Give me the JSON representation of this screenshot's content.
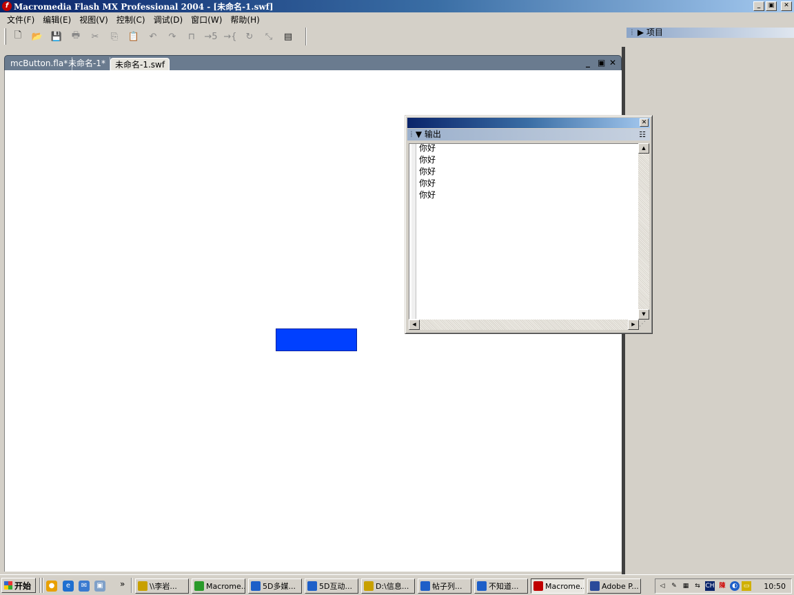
{
  "window": {
    "title": "Macromedia Flash MX Professional 2004 - [未命名-1.swf]",
    "controls": {
      "minimize": "_",
      "restore": "▣",
      "close": "✕"
    }
  },
  "menu": [
    "文件(F)",
    "编辑(E)",
    "视图(V)",
    "控制(C)",
    "调试(D)",
    "窗口(W)",
    "帮助(H)"
  ],
  "toolbar": {
    "icons": [
      "new-file-icon",
      "open-folder-icon",
      "save-icon",
      "print-icon",
      "cut-icon",
      "copy-icon",
      "paste-icon",
      "undo-icon",
      "redo-icon",
      "snap-magnet-icon",
      "smooth-icon",
      "straighten-icon",
      "rotate-icon",
      "scale-icon",
      "align-icon"
    ],
    "glyphs": [
      "🗋",
      "📂",
      "💾",
      "🖶",
      "✂",
      "⎘",
      "📋",
      "↶",
      "↷",
      "⊓",
      "→5",
      "→{",
      "↻",
      "⤡",
      "▤"
    ]
  },
  "documents": {
    "tabs": [
      "mcButton.fla*",
      "未命名-1*",
      "未命名-1.swf"
    ],
    "active_tab": 2,
    "controls": {
      "minimize": "_",
      "restore": "▣",
      "close": "✕"
    }
  },
  "stage": {
    "background": "#ffffff",
    "button_color": "#0040ff"
  },
  "right_panel": {
    "project_label": "项目"
  },
  "output_panel": {
    "title": "输出",
    "close": "✕",
    "lines": [
      "你好",
      "你好",
      "你好",
      "你好",
      "你好"
    ]
  },
  "taskbar": {
    "start_label": "开始",
    "overflow": "»",
    "tasks": [
      {
        "label": "\\\\李岩...",
        "color": "#c8a000"
      },
      {
        "label": "Macrome...",
        "color": "#2a9a2a"
      },
      {
        "label": "5D多媒...",
        "color": "#1e5fc8"
      },
      {
        "label": "5D互动...",
        "color": "#1e5fc8"
      },
      {
        "label": "D:\\信息...",
        "color": "#c8a000"
      },
      {
        "label": "帖子列...",
        "color": "#1e5fc8"
      },
      {
        "label": "不知道...",
        "color": "#1e5fc8"
      },
      {
        "label": "Macrome...",
        "color": "#c00000"
      },
      {
        "label": "Adobe P...",
        "color": "#2a4a9a"
      }
    ],
    "active_task": 7,
    "tray_ime": "CH",
    "clock": "10:50"
  }
}
